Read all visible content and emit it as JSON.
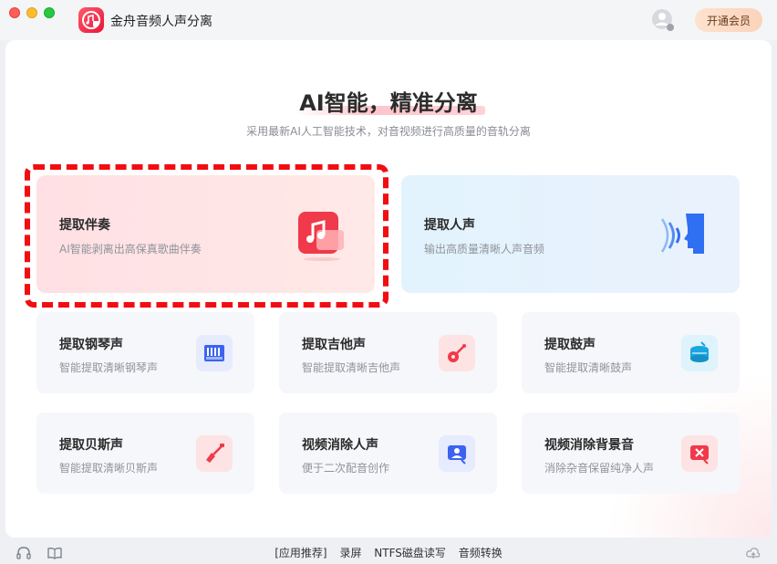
{
  "app": {
    "title": "金舟音频人声分离"
  },
  "header": {
    "vip_label": "开通会员"
  },
  "hero": {
    "title": "AI智能，精准分离",
    "subtitle": "采用最新AI人工智能技术，对音视频进行高质量的音轨分离"
  },
  "features": [
    {
      "title": "提取伴奏",
      "desc": "AI智能剥离出高保真歌曲伴奏",
      "icon": "music-note-icon"
    },
    {
      "title": "提取人声",
      "desc": "输出高质量清晰人声音频",
      "icon": "voice-head-icon"
    },
    {
      "title": "提取钢琴声",
      "desc": "智能提取清晰钢琴声",
      "icon": "piano-icon"
    },
    {
      "title": "提取吉他声",
      "desc": "智能提取清晰吉他声",
      "icon": "guitar-icon"
    },
    {
      "title": "提取鼓声",
      "desc": "智能提取清晰鼓声",
      "icon": "drum-icon"
    },
    {
      "title": "提取贝斯声",
      "desc": "智能提取清晰贝斯声",
      "icon": "bass-guitar-icon"
    },
    {
      "title": "视频消除人声",
      "desc": "便于二次配音创作",
      "icon": "video-person-icon"
    },
    {
      "title": "视频消除背景音",
      "desc": "消除杂音保留纯净人声",
      "icon": "video-noise-icon"
    }
  ],
  "footer": {
    "links": [
      "[应用推荐]",
      "录屏",
      "NTFS磁盘读写",
      "音频转换"
    ]
  },
  "colors": {
    "accent": "#f0243f",
    "highlight_frame": "#f20d12",
    "vip_bg": "#fbd3bb"
  }
}
